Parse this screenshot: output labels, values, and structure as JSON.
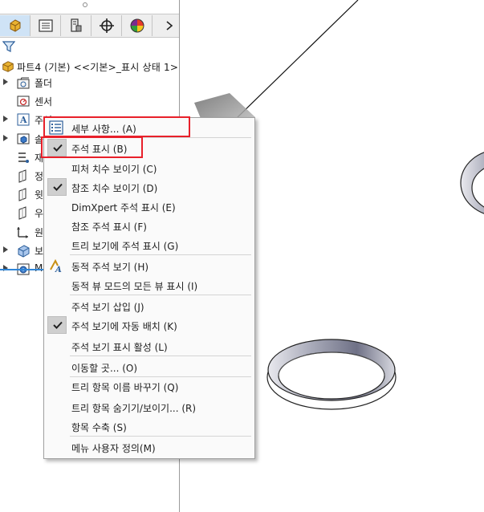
{
  "feature_manager": {
    "tabs": [
      {
        "name": "feature-manager-tab",
        "icon": "part-tree-icon",
        "active": true
      },
      {
        "name": "property-manager-tab",
        "icon": "property-list-icon",
        "active": false
      },
      {
        "name": "configuration-manager-tab",
        "icon": "configuration-icon",
        "active": false
      },
      {
        "name": "dimxpert-manager-tab",
        "icon": "crosshair-icon",
        "active": false
      },
      {
        "name": "display-manager-tab",
        "icon": "color-wheel-icon",
        "active": false
      }
    ],
    "next_tab_icon": "chevron-right-icon",
    "filter_icon": "filter-icon",
    "part_label": "파트4 (기본) <<기본>_표시 상태 1>",
    "tree_items": [
      {
        "label": "폴더",
        "icon": "history-folder-icon",
        "expandable": true
      },
      {
        "label": "센서",
        "icon": "sensor-icon",
        "expandable": false
      },
      {
        "label": "주석",
        "icon": "annotations-icon",
        "expandable": true
      },
      {
        "label": "솔",
        "icon": "solid-bodies-icon",
        "expandable": true
      },
      {
        "label": "재",
        "icon": "material-icon",
        "expandable": false
      },
      {
        "label": "정",
        "icon": "front-plane-icon",
        "expandable": false
      },
      {
        "label": "윗",
        "icon": "top-plane-icon",
        "expandable": false
      },
      {
        "label": "우",
        "icon": "right-plane-icon",
        "expandable": false
      },
      {
        "label": "원",
        "icon": "origin-icon",
        "expandable": false
      },
      {
        "label": "보",
        "icon": "boss-extrude-icon",
        "expandable": true
      },
      {
        "label": "M",
        "icon": "hole-wizard-icon",
        "expandable": true
      }
    ]
  },
  "context_menu": {
    "items": [
      {
        "label": "세부 사항... (A)",
        "icon": "details-list-icon",
        "checked": false,
        "highlighted": true
      },
      {
        "label": "주석 표시 (B)",
        "checked": true,
        "highlighted": true
      },
      {
        "label": "피처 치수 보이기 (C)",
        "checked": false
      },
      {
        "label": "참조 치수 보이기 (D)",
        "checked": true
      },
      {
        "label": "DimXpert 주석 표시 (E)",
        "checked": false
      },
      {
        "label": "참조 주석 표시 (F)",
        "checked": false
      },
      {
        "label": "트리 보기에 주석 표시 (G)",
        "checked": false
      },
      {
        "label": "동적 주석 보기 (H)",
        "icon": "dynamic-annotation-view-icon",
        "checked": false
      },
      {
        "label": "동적 뷰 모드의 모든 뷰 표시 (I)",
        "checked": false
      },
      {
        "label": "주석 보기 삽입 (J)",
        "checked": false
      },
      {
        "label": "주석 보기에 자동 배치 (K)",
        "checked": true
      },
      {
        "label": "주석 보기 표시 활성 (L)",
        "checked": false
      },
      {
        "label": "이동할 곳... (O)",
        "checked": false
      },
      {
        "label": "트리 항목 이름 바꾸기 (Q)",
        "checked": false
      },
      {
        "label": "트리 항목 숨기기/보이기... (R)",
        "checked": false
      },
      {
        "label": "항목 수축 (S)",
        "checked": false
      },
      {
        "label": "메뉴 사용자 정의(M)",
        "checked": false
      }
    ]
  },
  "colors": {
    "highlight_box": "#e8202a",
    "active_tab": "#cfe3f6",
    "check_background": "#cfcfcf",
    "tree_accent": "#2f86d8"
  }
}
